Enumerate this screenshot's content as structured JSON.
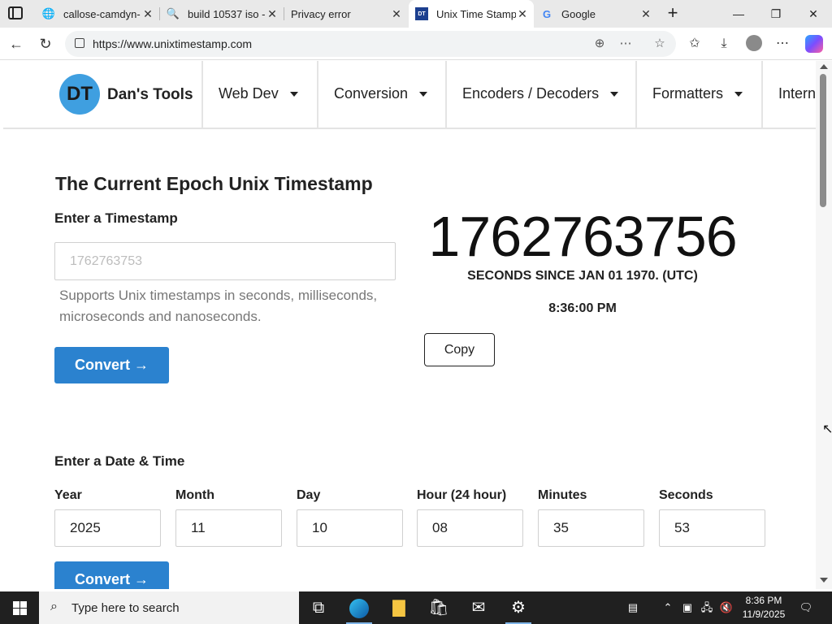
{
  "browser": {
    "tabs": [
      {
        "title": "callose-camdyn-",
        "icon": "globe-icon",
        "active": false
      },
      {
        "title": "build 10537 iso -",
        "icon": "search-icon",
        "active": false
      },
      {
        "title": "Privacy error",
        "icon": "",
        "active": false
      },
      {
        "title": "Unix Time Stamp",
        "icon": "dans-tools-icon",
        "active": true
      },
      {
        "title": "Google",
        "icon": "google-icon",
        "active": false
      }
    ],
    "url": "https://www.unixtimestamp.com"
  },
  "site": {
    "logo_initials": "DT",
    "brand": "Dan's Tools",
    "nav": [
      "Web Dev",
      "Conversion",
      "Encoders / Decoders",
      "Formatters",
      "Interne"
    ]
  },
  "main": {
    "title": "The Current Epoch Unix Timestamp",
    "enter_label": "Enter a Timestamp",
    "ts_placeholder": "1762763753",
    "hint": "Supports Unix timestamps in seconds, milliseconds, microseconds and nanoseconds.",
    "convert_label": "Convert →",
    "current_ts": "1762763756",
    "since_text": "SECONDS SINCE JAN 01 1970. (UTC)",
    "time_text": "8:36:00 PM",
    "copy_label": "Copy"
  },
  "datetime": {
    "heading": "Enter a Date & Time",
    "fields": [
      {
        "label": "Year",
        "value": "2025"
      },
      {
        "label": "Month",
        "value": "11"
      },
      {
        "label": "Day",
        "value": "10"
      },
      {
        "label": "Hour (24 hour)",
        "value": "08"
      },
      {
        "label": "Minutes",
        "value": "35"
      },
      {
        "label": "Seconds",
        "value": "53"
      }
    ],
    "convert_label": "Convert →"
  },
  "taskbar": {
    "search_placeholder": "Type here to search",
    "time": "8:36 PM",
    "date": "11/9/2025"
  },
  "colors": {
    "accent_blue": "#2b82cf",
    "logo_blue": "#3f9fe0"
  }
}
